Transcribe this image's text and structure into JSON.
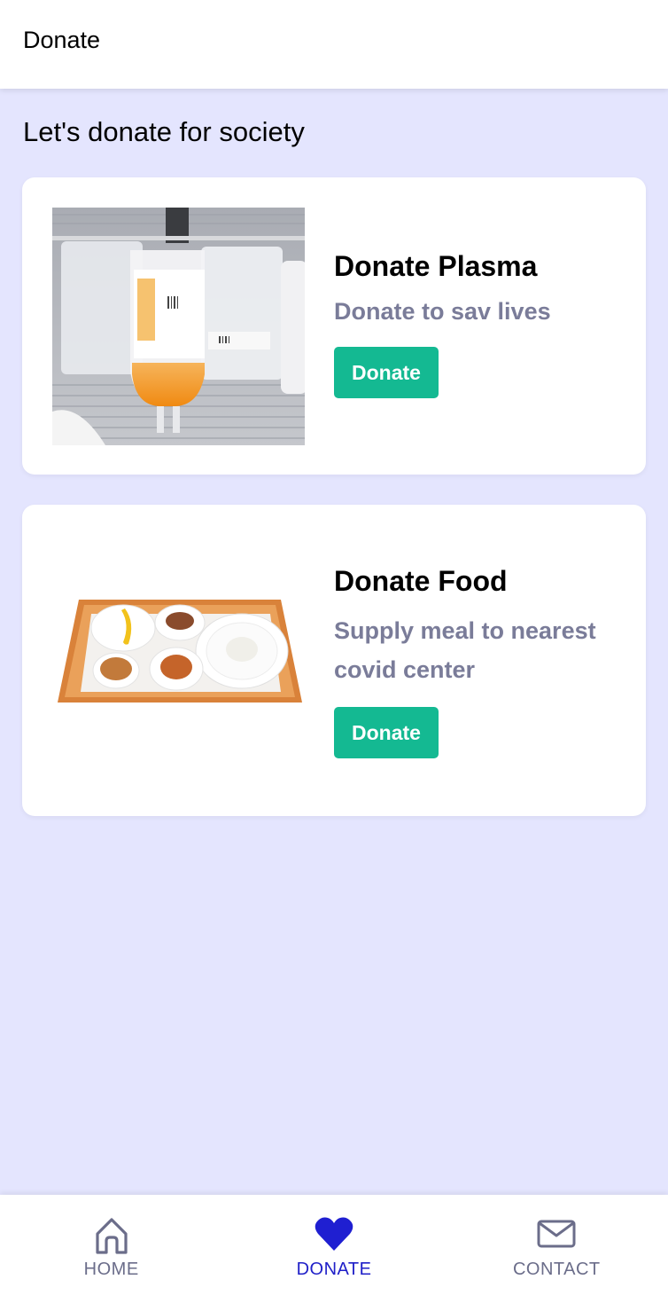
{
  "header": {
    "title": "Donate"
  },
  "main": {
    "heading": "Let's donate for society",
    "cards": [
      {
        "title": "Donate Plasma",
        "subtitle": "Donate to sav lives",
        "button_label": "Donate",
        "image": "plasma-bags-image"
      },
      {
        "title": "Donate Food",
        "subtitle": "Supply meal to nearest covid center",
        "button_label": "Donate",
        "image": "food-tray-image"
      }
    ]
  },
  "bottom_nav": {
    "items": [
      {
        "label": "HOME",
        "icon": "home-icon",
        "active": false
      },
      {
        "label": "DONATE",
        "icon": "heart-icon",
        "active": true
      },
      {
        "label": "CONTACT",
        "icon": "mail-icon",
        "active": false
      }
    ]
  },
  "colors": {
    "background": "#e4e5fe",
    "accent_button": "#14b992",
    "active_nav": "#2020c8",
    "subtitle": "#7a7c99"
  }
}
